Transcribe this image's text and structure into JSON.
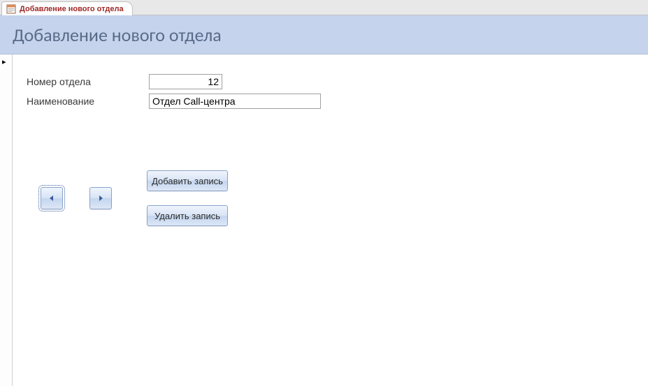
{
  "tab": {
    "label": "Добавление нового отдела"
  },
  "header": {
    "title": "Добавление нового отдела"
  },
  "fields": {
    "dept_number": {
      "label": "Номер отдела",
      "value": "12"
    },
    "dept_name": {
      "label": "Наименование",
      "value": "Отдел Call-центра"
    }
  },
  "buttons": {
    "add_record": "Добавить запись",
    "delete_record": "Удалить запись"
  }
}
